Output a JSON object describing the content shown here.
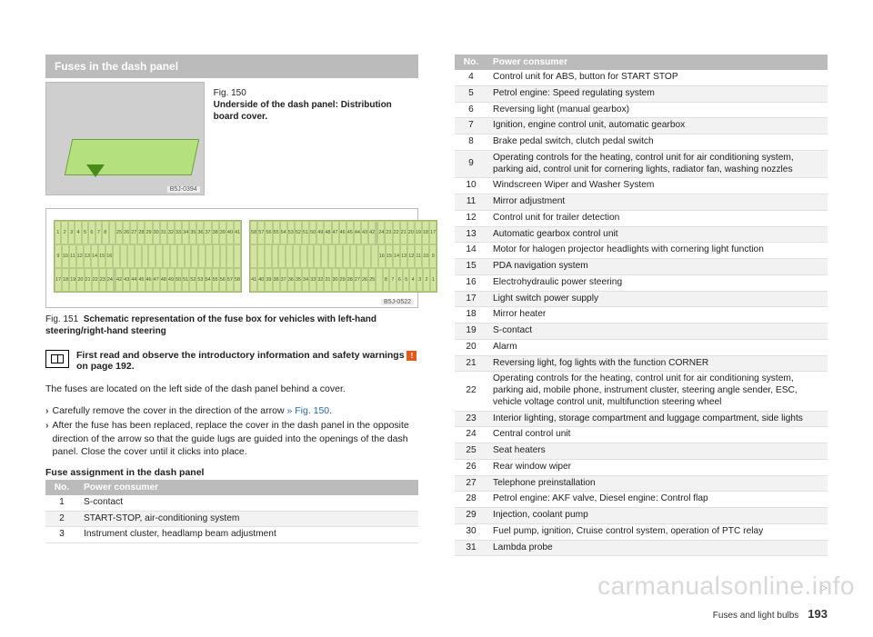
{
  "section_title": "Fuses in the dash panel",
  "fig150": {
    "num": "Fig. 150",
    "caption": "Underside of the dash panel: Distribution board cover.",
    "ref": "B5J-0394"
  },
  "fig151": {
    "num": "Fig. 151",
    "caption": "Schematic representation of the fuse box for vehicles with left-hand steering/right-hand steering",
    "ref": "B5J-0522",
    "left_rows": [
      [
        "1",
        "2",
        "3",
        "4",
        "5",
        "6",
        "7",
        "8",
        "",
        "25",
        "26",
        "27",
        "28",
        "29",
        "30",
        "31",
        "32",
        "33",
        "34",
        "35",
        "36",
        "37",
        "38",
        "39",
        "40",
        "41"
      ],
      [
        "9",
        "10",
        "11",
        "12",
        "13",
        "14",
        "15",
        "16",
        "",
        "",
        "",
        "",
        "",
        "",
        "",
        "",
        "",
        "",
        "",
        "",
        "",
        "",
        "",
        "",
        "",
        ""
      ],
      [
        "17",
        "18",
        "19",
        "20",
        "21",
        "22",
        "23",
        "24",
        "",
        "42",
        "43",
        "44",
        "45",
        "46",
        "47",
        "48",
        "49",
        "50",
        "51",
        "52",
        "53",
        "54",
        "55",
        "56",
        "57",
        "58"
      ]
    ],
    "right_rows": [
      [
        "58",
        "57",
        "56",
        "55",
        "54",
        "53",
        "52",
        "51",
        "50",
        "49",
        "48",
        "47",
        "46",
        "45",
        "44",
        "43",
        "42",
        "",
        "24",
        "23",
        "22",
        "21",
        "20",
        "19",
        "18",
        "17"
      ],
      [
        "",
        "",
        "",
        "",
        "",
        "",
        "",
        "",
        "",
        "",
        "",
        "",
        "",
        "",
        "",
        "",
        "",
        "",
        "16",
        "15",
        "14",
        "13",
        "12",
        "11",
        "10",
        "9"
      ],
      [
        "41",
        "40",
        "39",
        "38",
        "37",
        "36",
        "35",
        "34",
        "33",
        "32",
        "31",
        "30",
        "29",
        "28",
        "27",
        "26",
        "25",
        "",
        "8",
        "7",
        "6",
        "5",
        "4",
        "3",
        "2",
        "1"
      ]
    ]
  },
  "intro": {
    "text_a": "First read and observe the introductory information and safety warnings ",
    "text_b": " on page 192.",
    "warn_glyph": "!"
  },
  "body1": "The fuses are located on the left side of the dash panel behind a cover.",
  "steps": [
    {
      "pre": "Carefully remove the cover in the direction of the arrow ",
      "link": "» Fig. 150",
      "post": "."
    },
    {
      "pre": "After the fuse has been replaced, replace the cover in the dash panel in the opposite direction of the arrow so that the guide lugs are guided into the openings of the dash panel. Close the cover until it clicks into place.",
      "link": "",
      "post": ""
    }
  ],
  "assign_head": "Fuse assignment in the dash panel",
  "table_headers": {
    "no": "No.",
    "pc": "Power consumer"
  },
  "left_rows": [
    {
      "no": "1",
      "pc": "S-contact"
    },
    {
      "no": "2",
      "pc": "START-STOP, air-conditioning system"
    },
    {
      "no": "3",
      "pc": "Instrument cluster, headlamp beam adjustment"
    }
  ],
  "right_rows": [
    {
      "no": "4",
      "pc": "Control unit for ABS, button for START STOP"
    },
    {
      "no": "5",
      "pc": "Petrol engine: Speed regulating system"
    },
    {
      "no": "6",
      "pc": "Reversing light (manual gearbox)"
    },
    {
      "no": "7",
      "pc": "Ignition, engine control unit, automatic gearbox"
    },
    {
      "no": "8",
      "pc": "Brake pedal switch, clutch pedal switch"
    },
    {
      "no": "9",
      "pc": "Operating controls for the heating, control unit for air conditioning system, parking aid, control unit for cornering lights, radiator fan, washing nozzles"
    },
    {
      "no": "10",
      "pc": "Windscreen Wiper and Washer System"
    },
    {
      "no": "11",
      "pc": "Mirror adjustment"
    },
    {
      "no": "12",
      "pc": "Control unit for trailer detection"
    },
    {
      "no": "13",
      "pc": "Automatic gearbox control unit"
    },
    {
      "no": "14",
      "pc": "Motor for halogen projector headlights with cornering light function"
    },
    {
      "no": "15",
      "pc": "PDA navigation system"
    },
    {
      "no": "16",
      "pc": "Electrohydraulic power steering"
    },
    {
      "no": "17",
      "pc": "Light switch power supply"
    },
    {
      "no": "18",
      "pc": "Mirror heater"
    },
    {
      "no": "19",
      "pc": "S-contact"
    },
    {
      "no": "20",
      "pc": "Alarm"
    },
    {
      "no": "21",
      "pc": "Reversing light, fog lights with the function CORNER"
    },
    {
      "no": "22",
      "pc": "Operating controls for the heating, control unit for air conditioning system, parking aid, mobile phone, instrument cluster, steering angle sender, ESC, vehicle voltage control unit, multifunction steering wheel"
    },
    {
      "no": "23",
      "pc": "Interior lighting, storage compartment and luggage compartment, side lights"
    },
    {
      "no": "24",
      "pc": "Central control unit"
    },
    {
      "no": "25",
      "pc": "Seat heaters"
    },
    {
      "no": "26",
      "pc": "Rear window wiper"
    },
    {
      "no": "27",
      "pc": "Telephone preinstallation"
    },
    {
      "no": "28",
      "pc": "Petrol engine: AKF valve, Diesel engine: Control flap"
    },
    {
      "no": "29",
      "pc": "Injection, coolant pump"
    },
    {
      "no": "30",
      "pc": "Fuel pump, ignition, Cruise control system, operation of PTC relay"
    },
    {
      "no": "31",
      "pc": "Lambda probe"
    }
  ],
  "footer": {
    "section": "Fuses and light bulbs",
    "page": "193"
  },
  "watermark": "carmanualsonline.info",
  "continue_glyph": "▷"
}
